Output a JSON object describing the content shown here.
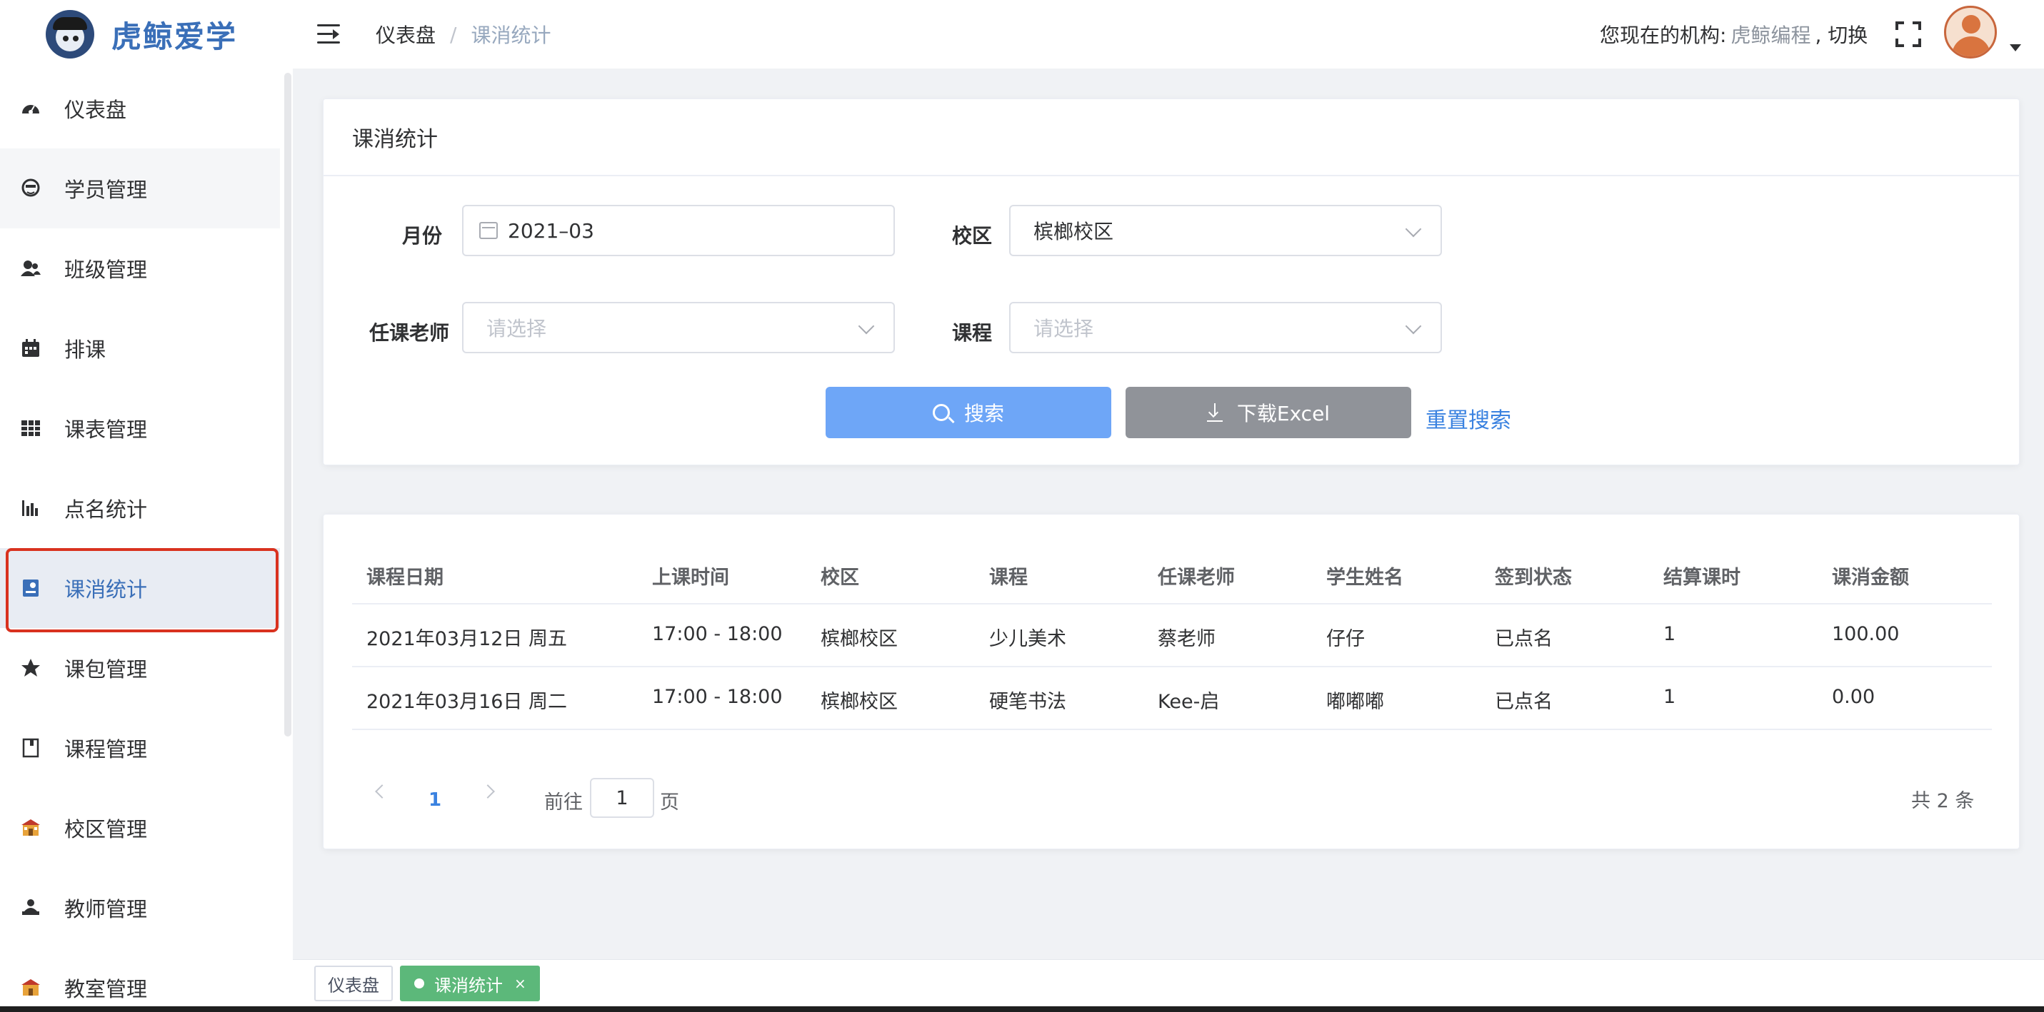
{
  "brand": {
    "name": "虎鲸爱学"
  },
  "header": {
    "breadcrumb": [
      "仪表盘",
      "课消统计"
    ],
    "breadcrumb_sep": "/",
    "org_prefix": "您现在的机构:",
    "org_name": "虎鲸编程",
    "org_switch": ", 切换"
  },
  "sidebar": {
    "items": [
      {
        "label": "仪表盘",
        "icon": "dashboard-icon"
      },
      {
        "label": "学员管理",
        "icon": "student-icon"
      },
      {
        "label": "班级管理",
        "icon": "class-icon"
      },
      {
        "label": "排课",
        "icon": "calendar-icon"
      },
      {
        "label": "课表管理",
        "icon": "grid-icon"
      },
      {
        "label": "点名统计",
        "icon": "bar-chart-icon"
      },
      {
        "label": "课消统计",
        "icon": "report-icon"
      },
      {
        "label": "课包管理",
        "icon": "star-icon"
      },
      {
        "label": "课程管理",
        "icon": "book-icon"
      },
      {
        "label": "校区管理",
        "icon": "school-icon"
      },
      {
        "label": "教师管理",
        "icon": "teacher-icon"
      },
      {
        "label": "教室管理",
        "icon": "classroom-icon"
      }
    ],
    "active_index": 6,
    "hover_index": 1
  },
  "filter": {
    "title": "课消统计",
    "month_label": "月份",
    "month_value": "2021–03",
    "campus_label": "校区",
    "campus_value": "槟榔校区",
    "teacher_label": "任课老师",
    "teacher_placeholder": "请选择",
    "course_label": "课程",
    "course_placeholder": "请选择",
    "search_button": "搜索",
    "excel_button": "下载Excel",
    "reset_link": "重置搜索"
  },
  "table": {
    "columns": [
      "课程日期",
      "上课时间",
      "校区",
      "课程",
      "任课老师",
      "学生姓名",
      "签到状态",
      "结算课时",
      "课消金额"
    ],
    "rows": [
      [
        "2021年03月12日 周五",
        "17:00 - 18:00",
        "槟榔校区",
        "少儿美术",
        "蔡老师",
        "仔仔",
        "已点名",
        "1",
        "100.00"
      ],
      [
        "2021年03月16日 周二",
        "17:00 - 18:00",
        "槟榔校区",
        "硬笔书法",
        "Kee-启",
        "嘟嘟嘟",
        "已点名",
        "1",
        "0.00"
      ]
    ]
  },
  "pagination": {
    "current": "1",
    "goto_prefix": "前往",
    "goto_value": "1",
    "goto_suffix": "页",
    "total": "共 2 条"
  },
  "tags": [
    {
      "label": "仪表盘"
    },
    {
      "label": "课消统计",
      "close": "×"
    }
  ],
  "colors": {
    "brand": "#3a6fb8",
    "primary_button": "#6ea6f7",
    "excel_button": "#909399",
    "active_tag": "#5cb87a",
    "highlight_outline": "#d9321f"
  }
}
